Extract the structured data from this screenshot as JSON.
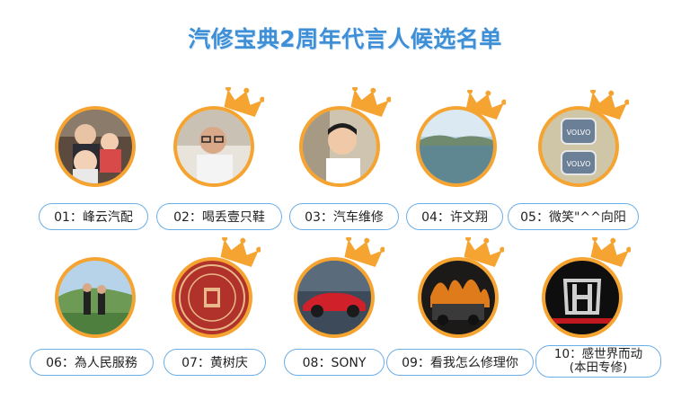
{
  "title": "汽修宝典2周年代言人候选名单",
  "candidates": [
    {
      "label": "01：峰云汽配",
      "crowned": false
    },
    {
      "label": "02：喝丢壹只鞋",
      "crowned": true
    },
    {
      "label": "03：汽车维修",
      "crowned": true
    },
    {
      "label": "04：许文翔",
      "crowned": true
    },
    {
      "label": "05：微笑\"^^向阳",
      "crowned": true
    },
    {
      "label": "06：為人民服務",
      "crowned": false
    },
    {
      "label": "07：黄树庆",
      "crowned": true
    },
    {
      "label": "08：SONY",
      "crowned": true
    },
    {
      "label": "09：看我怎么修理你",
      "crowned": true
    },
    {
      "label_line1": "10：感世界而动",
      "label_line2": "(本田专修)",
      "crowned": true
    }
  ],
  "colors": {
    "title": "#3f8fd6",
    "ring": "#f6a431",
    "crown": "#f6a431",
    "label_border": "#6aaee8"
  }
}
